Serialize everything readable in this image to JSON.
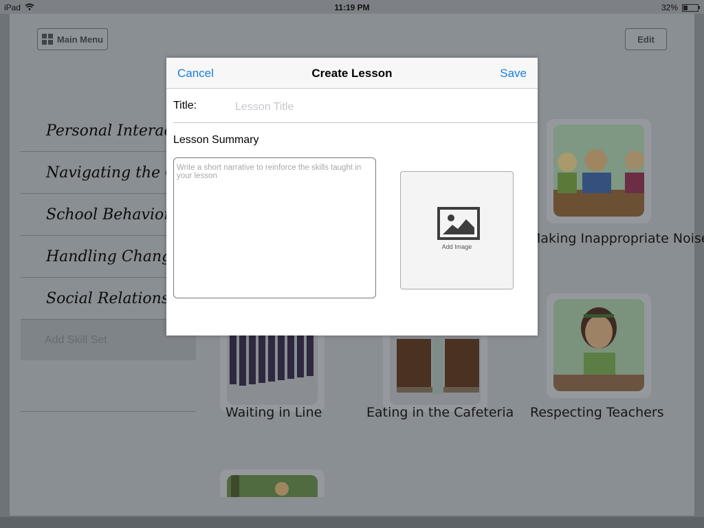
{
  "status_bar": {
    "device": "iPad",
    "time": "11:19 PM",
    "battery": "32%"
  },
  "toolbar": {
    "main_menu_label": "Main Menu",
    "edit_label": "Edit"
  },
  "sidebar": {
    "items": [
      {
        "label": "Personal Interactions"
      },
      {
        "label": "Navigating the Community"
      },
      {
        "label": "School Behavior"
      },
      {
        "label": "Handling Change"
      },
      {
        "label": "Social Relationships"
      }
    ],
    "add_label": "Add Skill Set"
  },
  "lessons": [
    {
      "label": "Making Inappropriate Noises",
      "icon": "classmates-illustration"
    },
    {
      "label": "Waiting in Line",
      "icon": "line-of-people-illustration"
    },
    {
      "label": "Eating in the Cafeteria",
      "icon": "cafeteria-illustration"
    },
    {
      "label": "Respecting Teachers",
      "icon": "sad-girl-at-desk-illustration"
    }
  ],
  "modal": {
    "cancel_label": "Cancel",
    "title": "Create Lesson",
    "save_label": "Save",
    "title_field_label": "Title:",
    "title_placeholder": "Lesson Title",
    "summary_label": "Lesson Summary",
    "summary_placeholder": "Write a short narrative to reinforce the skills taught in your lesson",
    "add_image_label": "Add Image"
  },
  "colors": {
    "accent": "#1a7ddc",
    "overlay": "#8a8f94"
  }
}
